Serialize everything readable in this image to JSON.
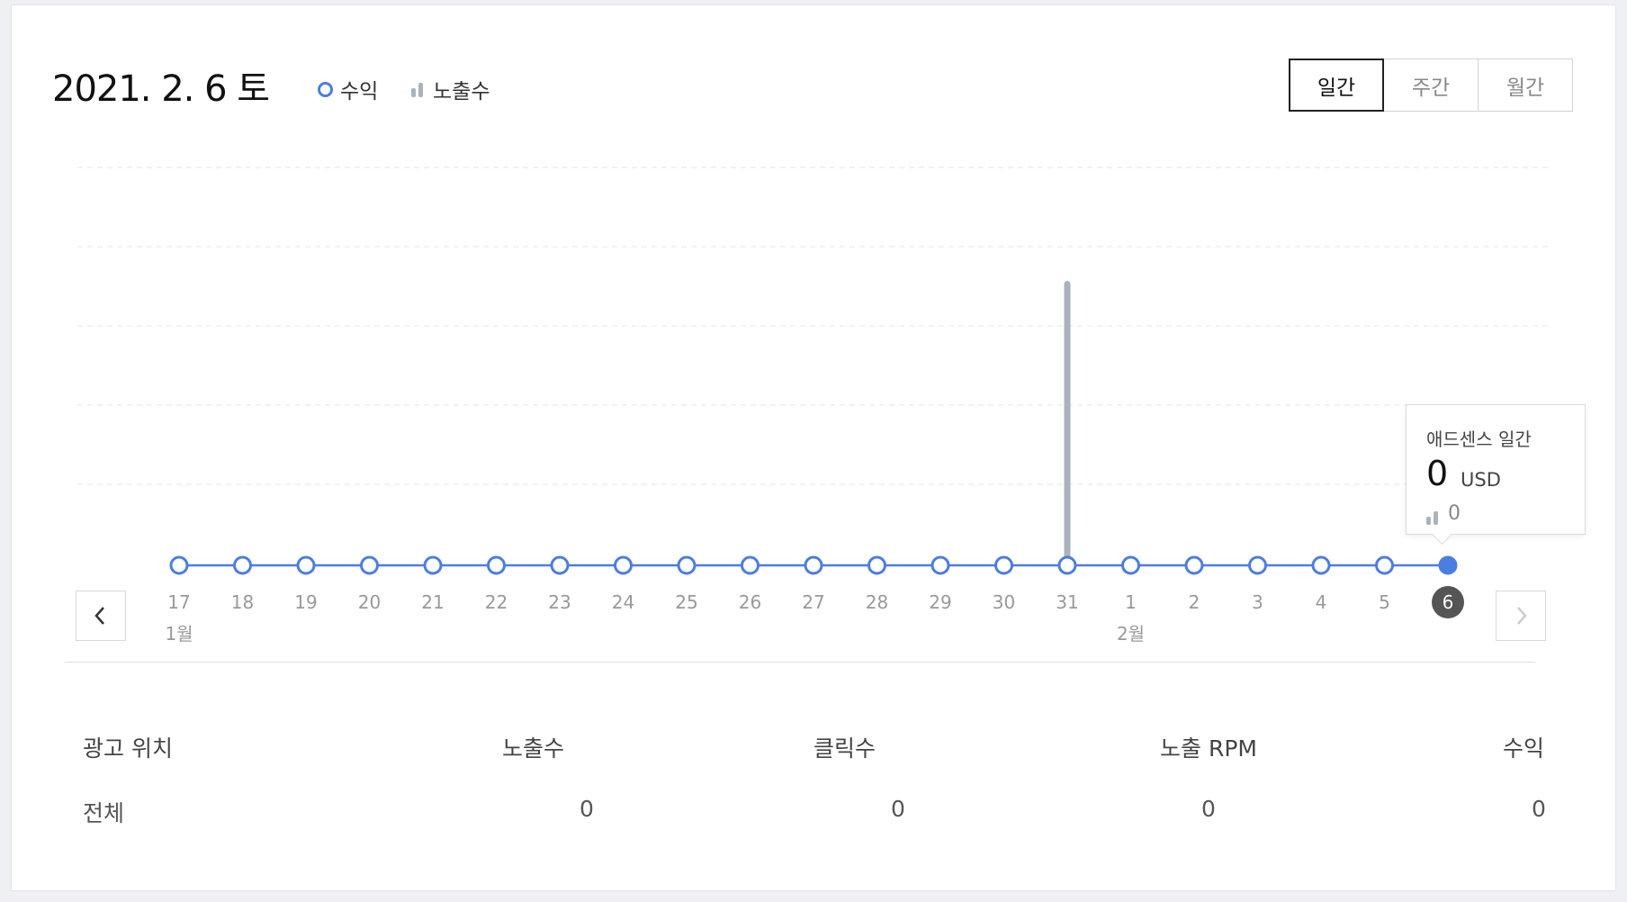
{
  "header": {
    "date": "2021. 2. 6 토",
    "legend": {
      "revenue": "수익",
      "impressions": "노출수"
    },
    "period_tabs": [
      {
        "label": "일간",
        "active": true
      },
      {
        "label": "주간",
        "active": false
      },
      {
        "label": "월간",
        "active": false
      }
    ]
  },
  "chart_data": {
    "type": "line",
    "x": [
      "17",
      "18",
      "19",
      "20",
      "21",
      "22",
      "23",
      "24",
      "25",
      "26",
      "27",
      "28",
      "29",
      "30",
      "31",
      "1",
      "2",
      "3",
      "4",
      "5",
      "6"
    ],
    "month_labels": [
      {
        "at": "17",
        "label": "1월"
      },
      {
        "at": "1",
        "label": "2월"
      }
    ],
    "series": [
      {
        "name": "수익",
        "kind": "line",
        "color": "#4c7de0",
        "values": [
          0,
          0,
          0,
          0,
          0,
          0,
          0,
          0,
          0,
          0,
          0,
          0,
          0,
          0,
          0,
          0,
          0,
          0,
          0,
          0,
          0
        ]
      },
      {
        "name": "노출수",
        "kind": "bar",
        "color": "#aab2be",
        "values": [
          0,
          0,
          0,
          0,
          0,
          0,
          0,
          0,
          0,
          0,
          0,
          0,
          0,
          0,
          1,
          0,
          0,
          0,
          0,
          0,
          0
        ]
      }
    ],
    "selected": "6",
    "grid": "dashed horizontal",
    "ylim": [
      0,
      1.4
    ]
  },
  "tooltip": {
    "title": "애드센스 일간",
    "value": "0",
    "unit": "USD",
    "impressions": "0"
  },
  "table": {
    "headers": [
      "광고 위치",
      "노출수",
      "클릭수",
      "노출 RPM",
      "수익"
    ],
    "rows": [
      [
        "전체",
        "0",
        "0",
        "0",
        "0"
      ]
    ]
  },
  "colors": {
    "accent": "#4c7de0",
    "bar": "#aab2be",
    "selected_day_bg": "#555555"
  },
  "icons": {
    "prev": "chevron-left-icon",
    "next": "chevron-right-icon"
  }
}
